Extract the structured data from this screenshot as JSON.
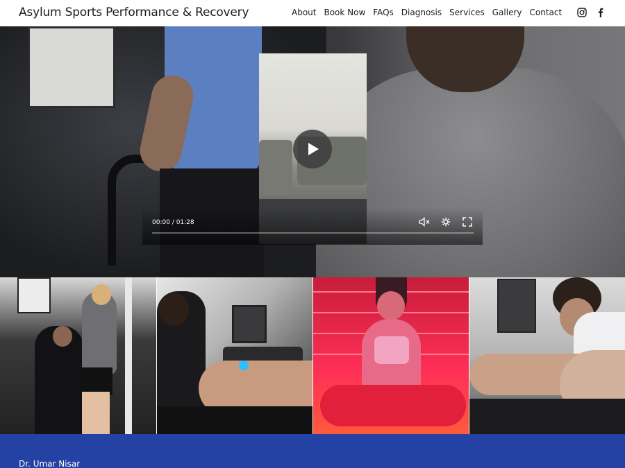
{
  "header": {
    "site_title": "Asylum Sports Performance & Recovery",
    "nav": [
      {
        "label": "About"
      },
      {
        "label": "Book Now"
      },
      {
        "label": "FAQs"
      },
      {
        "label": "Diagnosis"
      },
      {
        "label": "Services"
      },
      {
        "label": "Gallery"
      },
      {
        "label": "Contact"
      }
    ],
    "social": [
      {
        "icon": "instagram-icon"
      },
      {
        "icon": "facebook-icon"
      }
    ]
  },
  "video": {
    "time_display": "00:00 / 01:28",
    "progress": 0,
    "icons": [
      "play-icon",
      "volume-icon",
      "settings-icon",
      "fullscreen-icon"
    ]
  },
  "footer": {
    "name": "Dr. Umar Nisar"
  },
  "colors": {
    "footer_bg": "#2442a4",
    "text": "#1c1c1c",
    "sauna_red": "#ff2f57"
  }
}
